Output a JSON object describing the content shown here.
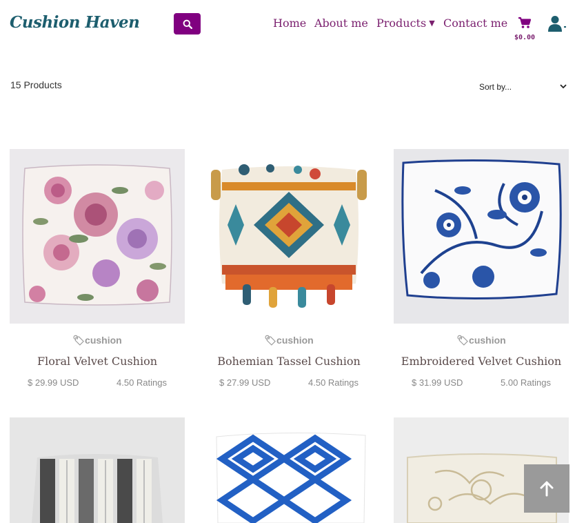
{
  "brand": {
    "name": "Cushion Haven"
  },
  "nav": {
    "items": [
      {
        "label": "Home"
      },
      {
        "label": "About me"
      },
      {
        "label": "Products"
      },
      {
        "label": "Contact me"
      }
    ],
    "cart_total": "$0.00"
  },
  "toolbar": {
    "count": "15 Products",
    "sort": {
      "selected": "Sort by..."
    }
  },
  "products": [
    {
      "tag": "cushion",
      "name": "Floral Velvet Cushion",
      "price": "$ 29.99 USD",
      "rating": "4.50 Ratings",
      "image": "floral-cushion"
    },
    {
      "tag": "cushion",
      "name": "Bohemian Tassel Cushion",
      "price": "$ 27.99 USD",
      "rating": "4.50 Ratings",
      "image": "bohemian-cushion"
    },
    {
      "tag": "cushion",
      "name": "Embroidered Velvet Cushion",
      "price": "$ 31.99 USD",
      "rating": "5.00 Ratings",
      "image": "embroidered-cushion"
    },
    {
      "tag": "",
      "name": "",
      "price": "",
      "rating": "",
      "image": "knit-cushion"
    },
    {
      "tag": "",
      "name": "",
      "price": "",
      "rating": "",
      "image": "geometric-cushion"
    },
    {
      "tag": "",
      "name": "",
      "price": "",
      "rating": "",
      "image": "damask-cushion"
    }
  ],
  "colors": {
    "brand": "#1d5e6e",
    "accent": "#800080",
    "nav_text": "#7a1f6e",
    "muted": "#999999"
  },
  "icons": {
    "search": "search-icon",
    "cart": "cart-icon",
    "user": "user-icon",
    "tag": "tag-icon",
    "back_to_top": "arrow-up-icon"
  }
}
